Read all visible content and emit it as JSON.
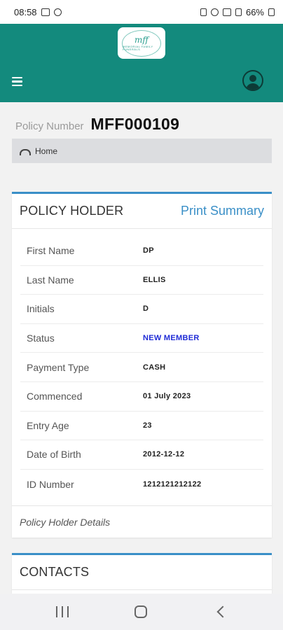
{
  "status_bar": {
    "time": "08:58",
    "battery": "66%"
  },
  "header": {
    "logo_text": "mff",
    "logo_caption": "MEMORIAL FAMILY FUNERALS"
  },
  "policy": {
    "label": "Policy Number",
    "number": "MFF000109"
  },
  "breadcrumb": {
    "home_label": "Home"
  },
  "policy_holder": {
    "title": "POLICY HOLDER",
    "print_label": "Print Summary",
    "rows": [
      {
        "label": "First Name",
        "value": "DP"
      },
      {
        "label": "Last Name",
        "value": "ELLIS"
      },
      {
        "label": "Initials",
        "value": "D"
      },
      {
        "label": "Status",
        "value": "NEW MEMBER"
      },
      {
        "label": "Payment Type",
        "value": "CASH"
      },
      {
        "label": "Commenced",
        "value": "01 July 2023"
      },
      {
        "label": "Entry Age",
        "value": "23"
      },
      {
        "label": "Date of Birth",
        "value": "2012-12-12"
      },
      {
        "label": "ID Number",
        "value": "1212121212122"
      }
    ],
    "footer": "Policy Holder Details"
  },
  "contacts": {
    "title": "CONTACTS"
  },
  "colors": {
    "app_bar": "#138a7d",
    "accent": "#3a8fc7",
    "status_value": "#1f2bd6"
  }
}
